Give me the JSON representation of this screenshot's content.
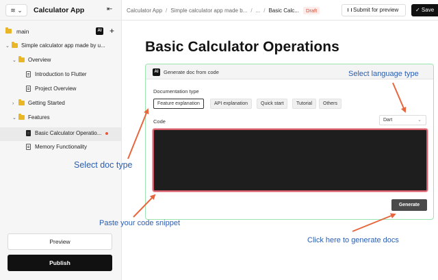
{
  "sidebar": {
    "layers_label": "≋ ⌄",
    "app_title": "Calculator App",
    "collapse_icon": "collapse-sidebar-icon",
    "branch": "main",
    "ai_label": "AI",
    "add_label": "+",
    "tree": [
      {
        "label": "Simple calculator app made by u...",
        "type": "folder",
        "level": 0,
        "expanded": true
      },
      {
        "label": "Overview",
        "type": "folder",
        "level": 1,
        "expanded": true
      },
      {
        "label": "Introduction to Flutter",
        "type": "doc",
        "level": 2
      },
      {
        "label": "Project Overview",
        "type": "doc",
        "level": 2
      },
      {
        "label": "Getting Started",
        "type": "folder",
        "level": 1,
        "expanded": false
      },
      {
        "label": "Features",
        "type": "folder",
        "level": 1,
        "expanded": true
      },
      {
        "label": "Basic Calculator Operatio...",
        "type": "doc",
        "level": 2,
        "active": true
      },
      {
        "label": "Memory Functionality",
        "type": "doc",
        "level": 2
      }
    ],
    "preview_label": "Preview",
    "publish_label": "Publish"
  },
  "topbar": {
    "breadcrumbs": [
      "Calculator App",
      "Simple calculator app made b...",
      "...",
      "Basic Calc..."
    ],
    "status": "Draft",
    "submit_label": "Submit for preview",
    "save_label": "✓ Save"
  },
  "main": {
    "title": "Basic Calculator Operations",
    "card": {
      "ai_label": "AI",
      "header": "Generate doc from code",
      "doc_type_label": "Documentation type",
      "doc_types": [
        "Feature explanation",
        "API explanation",
        "Quick start",
        "Tutorial",
        "Others"
      ],
      "selected_doc_type": "Feature explanation",
      "code_label": "Code",
      "language": "Dart",
      "generate_label": "Generate"
    }
  },
  "annotations": {
    "select_language": "Select language type",
    "select_doc_type": "Select doc type",
    "paste_code": "Paste your code snippet",
    "generate_docs": "Click here to generate docs"
  },
  "colors": {
    "accent_orange": "#e8663d",
    "annotation_blue": "#2a5db0",
    "card_border": "#9be3b0",
    "code_bg": "#1e1e1e",
    "draft_red": "#d9482f"
  }
}
